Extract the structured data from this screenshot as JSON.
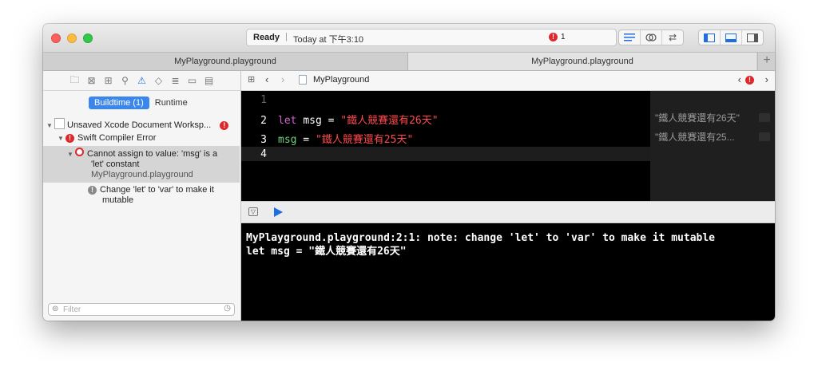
{
  "toolbar": {
    "status": "Ready",
    "separator": "|",
    "time": "Today at 下午3:10",
    "error_count": "1"
  },
  "tabs": [
    {
      "label": "MyPlayground.playground"
    },
    {
      "label": "MyPlayground.playground"
    }
  ],
  "tab_add": "+",
  "navigator": {
    "segments": [
      "Buildtime (1)",
      "Runtime"
    ],
    "issues": {
      "workspace": "Unsaved Xcode Document Worksp...",
      "group": "Swift Compiler Error",
      "error_line1": "Cannot assign to value: 'msg' is a",
      "error_line2": "'let' constant",
      "error_file": "MyPlayground.playground",
      "fixit_line1": "Change 'let' to 'var' to make it",
      "fixit_line2": "mutable"
    },
    "filter_placeholder": "Filter"
  },
  "jumpbar": {
    "file": "MyPlayground"
  },
  "code": {
    "lines": [
      {
        "num": "1"
      },
      {
        "num": "2",
        "kw": "let",
        "name": "msg",
        "op": " = ",
        "str": "\"鐵人競賽還有26天\""
      },
      {
        "num": "3",
        "name": "msg",
        "op": " = ",
        "str": "\"鐵人競賽還有25天\""
      },
      {
        "num": "4"
      }
    ]
  },
  "results": [
    "\"鐵人競賽還有26天\"",
    "\"鐵人競賽還有25..."
  ],
  "console": {
    "lines": [
      "MyPlayground.playground:2:1: note: change 'let' to 'var' to make it mutable",
      "let msg = \"鐵人競賽還有26天\""
    ]
  },
  "colors": {
    "keyword": "#d064cf",
    "string": "#ff4a4f",
    "variable": "#6fd47d",
    "error": "#e0272b",
    "accent": "#3a86ec"
  }
}
